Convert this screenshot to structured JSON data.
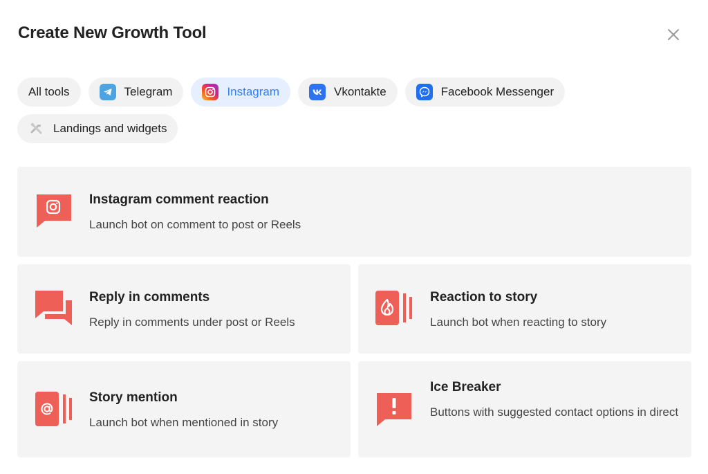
{
  "header": {
    "title": "Create New Growth Tool",
    "close_icon": "close-icon"
  },
  "filters": {
    "items": [
      {
        "label": "All tools",
        "icon": ""
      },
      {
        "label": "Telegram",
        "icon": "telegram-icon"
      },
      {
        "label": "Instagram",
        "icon": "instagram-icon",
        "active": true
      },
      {
        "label": "Vkontakte",
        "icon": "vk-icon"
      },
      {
        "label": "Facebook Messenger",
        "icon": "messenger-icon"
      },
      {
        "label": "Landings and widgets",
        "icon": "tools-icon"
      }
    ]
  },
  "tools": [
    {
      "title": "Instagram comment reaction",
      "description": "Launch bot on comment to post or Reels",
      "icon": "instagram-comment-icon"
    },
    {
      "title": "Reply in comments",
      "description": "Reply in comments under post or Reels",
      "icon": "chat-bubbles-icon"
    },
    {
      "title": "Reaction to story",
      "description": "Launch bot when reacting to story",
      "icon": "story-reaction-icon"
    },
    {
      "title": "Story mention",
      "description": "Launch bot when mentioned in story",
      "icon": "story-mention-icon"
    },
    {
      "title": "Ice Breaker",
      "description": "Buttons with suggested contact options in direct",
      "icon": "exclamation-bubble-icon"
    }
  ],
  "colors": {
    "accent": "#2f7ef6",
    "active_chip_bg": "#e5efff",
    "tool_icon": "#ee5f58",
    "card_bg": "#f4f4f4",
    "telegram": "#4ea4e0",
    "vk": "#2d72f0",
    "messenger": "#1f6ff0"
  }
}
